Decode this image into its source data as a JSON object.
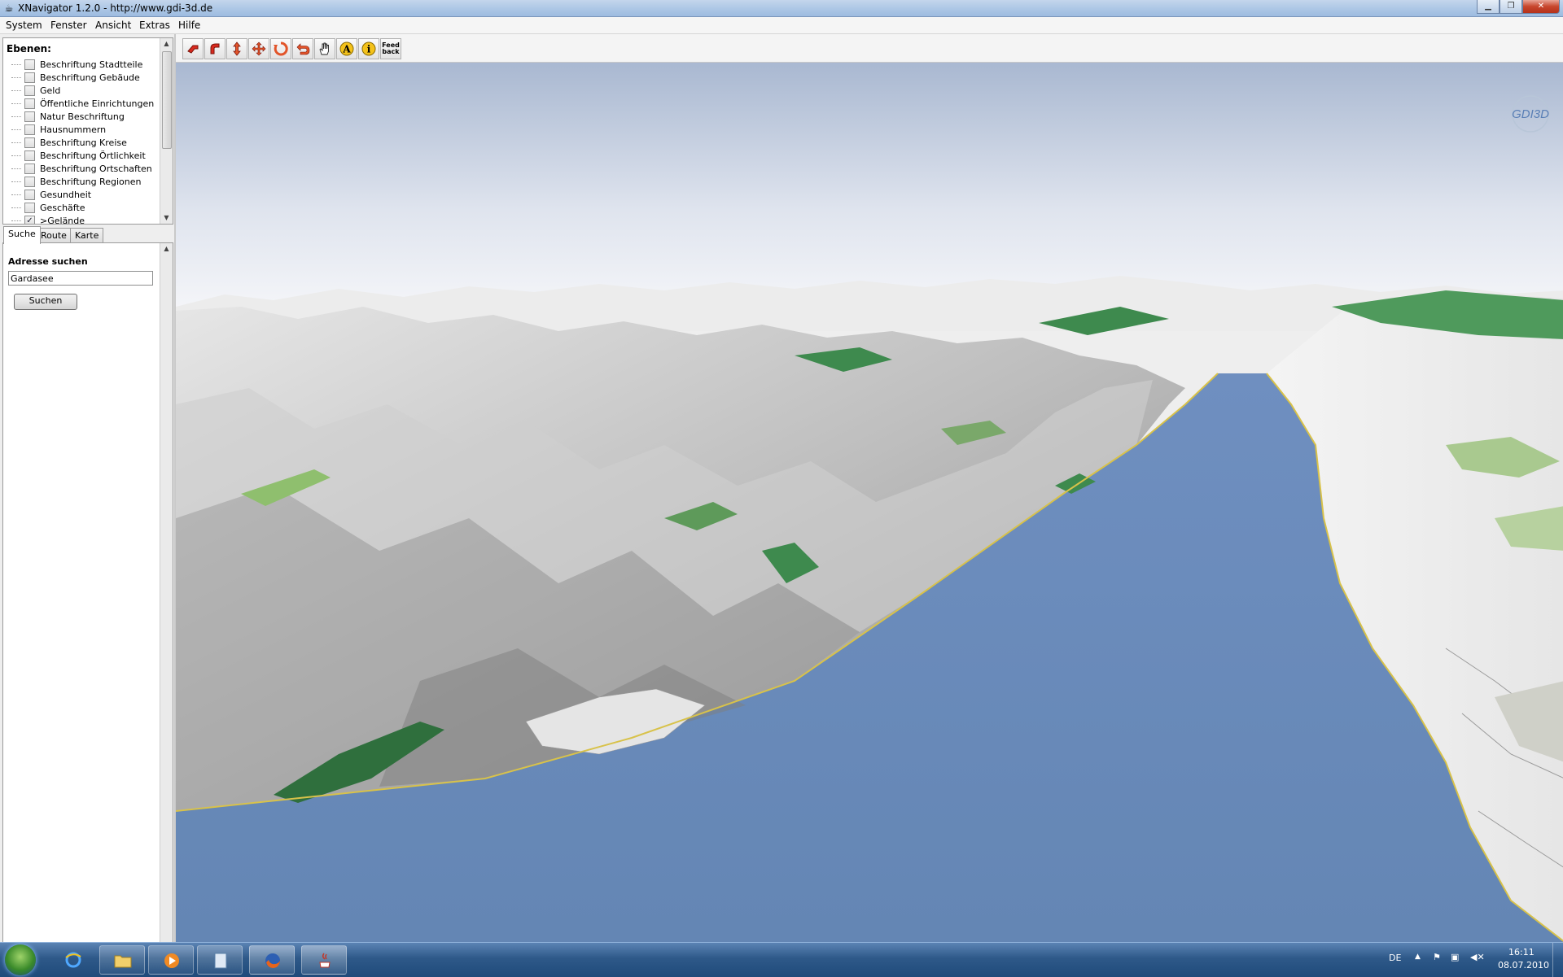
{
  "window": {
    "title": "XNavigator 1.2.0 - http://www.gdi-3d.de"
  },
  "menu": {
    "items": [
      "System",
      "Fenster",
      "Ansicht",
      "Extras",
      "Hilfe"
    ]
  },
  "layers": {
    "heading": "Ebenen:",
    "items": [
      {
        "label": "Beschriftung Stadtteile",
        "checked": false
      },
      {
        "label": "Beschriftung Gebäude",
        "checked": false
      },
      {
        "label": "Geld",
        "checked": false
      },
      {
        "label": "Öffentliche Einrichtungen",
        "checked": false
      },
      {
        "label": "Natur Beschriftung",
        "checked": false
      },
      {
        "label": "Hausnummern",
        "checked": false
      },
      {
        "label": "Beschriftung Kreise",
        "checked": false
      },
      {
        "label": "Beschriftung Örtlichkeit",
        "checked": false
      },
      {
        "label": "Beschriftung Ortschaften",
        "checked": false
      },
      {
        "label": "Beschriftung Regionen",
        "checked": false
      },
      {
        "label": "Gesundheit",
        "checked": false
      },
      {
        "label": "Geschäfte",
        "checked": false
      },
      {
        "label": ">Gelände",
        "checked": true
      }
    ]
  },
  "tabs": [
    {
      "label": "Suche",
      "active": true
    },
    {
      "label": "Route",
      "active": false
    },
    {
      "label": "Karte",
      "active": false
    }
  ],
  "search": {
    "heading": "Adresse suchen",
    "value": "Gardasee",
    "button_label": "Suchen"
  },
  "toolbar": {
    "tools": [
      {
        "icon": "rotate-left-icon"
      },
      {
        "icon": "tilt-icon"
      },
      {
        "icon": "move-vertical-icon"
      },
      {
        "icon": "move-all-directions-icon"
      },
      {
        "icon": "reset-view-icon"
      },
      {
        "icon": "undo-icon"
      },
      {
        "icon": "pan-hand-icon"
      },
      {
        "icon": "text-label-icon"
      },
      {
        "icon": "info-icon"
      },
      {
        "icon": "feedback-icon",
        "label": "Feed back"
      }
    ]
  },
  "viewer": {
    "watermark": "GDI3D",
    "sky_color": "#b7c4d9",
    "water_color": "#6688b8",
    "terrain_color": "#dcdcdc",
    "forest_color": "#3e8a4e"
  },
  "taskbar": {
    "apps": [
      "internet-explorer-icon",
      "folder-icon",
      "media-player-icon",
      "notepad-icon",
      "firefox-icon",
      "java-icon"
    ],
    "tray": {
      "lang": "DE",
      "time": "16:11",
      "date": "08.07.2010"
    }
  }
}
